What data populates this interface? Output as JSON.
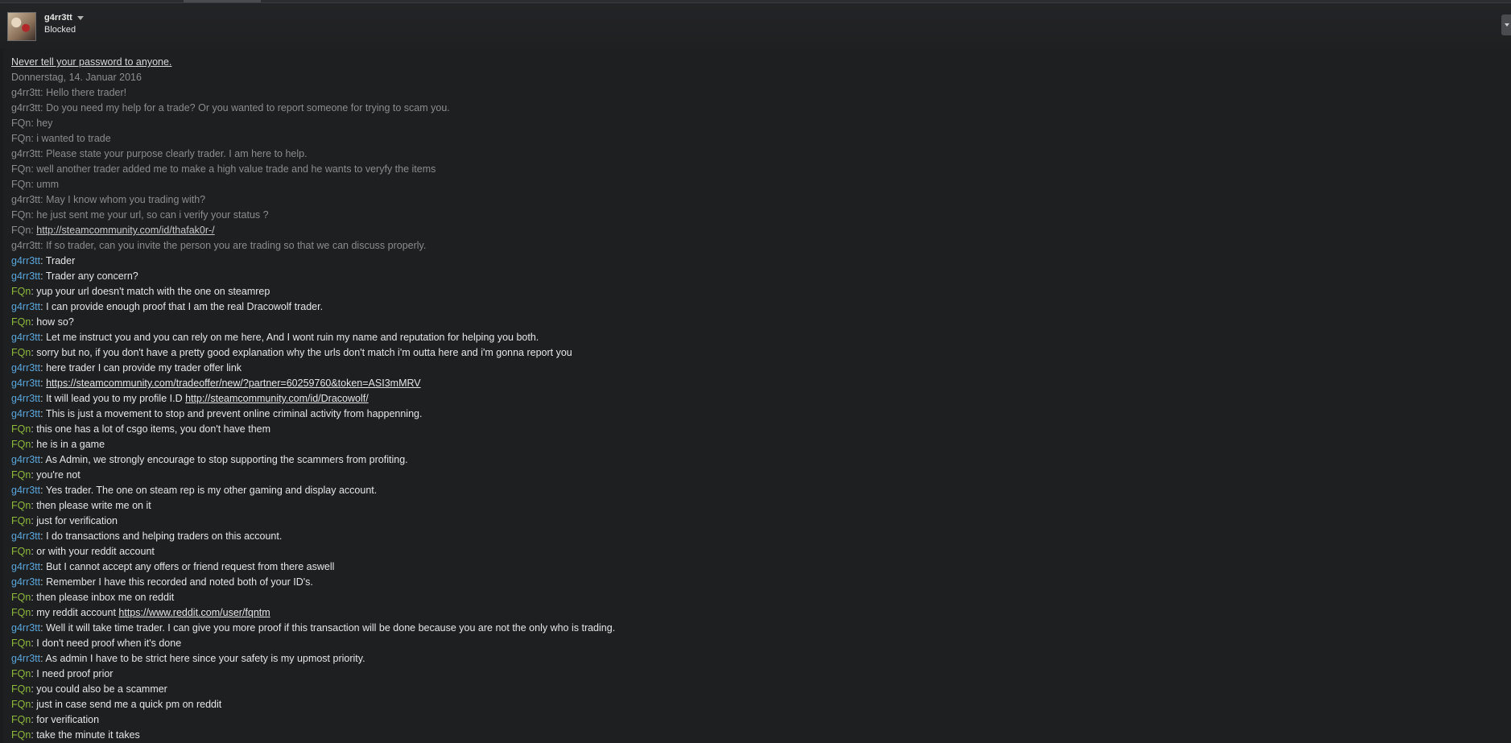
{
  "header": {
    "user_name": "g4rr3tt",
    "status": "Blocked"
  },
  "chat": {
    "warning": "Never tell your password to anyone.",
    "date": "Donnerstag, 14. Januar 2016",
    "messages": [
      {
        "sender": "g4rr3tt",
        "text": "Hello there trader!",
        "read": true
      },
      {
        "sender": "g4rr3tt",
        "text": "Do you need my help for a trade? Or you wanted to report someone for trying to scam you.",
        "read": true
      },
      {
        "sender": "FQn",
        "text": "hey",
        "read": true
      },
      {
        "sender": "FQn",
        "text": "i wanted to trade",
        "read": true
      },
      {
        "sender": "g4rr3tt",
        "text": "Please state your purpose clearly trader. I am here to help.",
        "read": true
      },
      {
        "sender": "FQn",
        "text": "well another trader added  me to make a high value trade and he wants to veryfy the items",
        "read": true
      },
      {
        "sender": "FQn",
        "text": "umm",
        "read": true
      },
      {
        "sender": "g4rr3tt",
        "text": "May I know whom you trading with?",
        "read": true
      },
      {
        "sender": "FQn",
        "text": "he just sent me your url, so can i verify your status ?",
        "read": true
      },
      {
        "sender": "FQn",
        "text": "",
        "link": "http://steamcommunity.com/id/thafak0r-/",
        "read": true
      },
      {
        "sender": "g4rr3tt",
        "text": "If so trader, can you invite the person you are trading so that we can discuss properly.",
        "read": true
      },
      {
        "sender": "g4rr3tt",
        "text": "Trader",
        "read": false
      },
      {
        "sender": "g4rr3tt",
        "text": "Trader any concern?",
        "read": false
      },
      {
        "sender": "FQn",
        "text": "yup your url doesn't match with the one on steamrep",
        "read": false
      },
      {
        "sender": "g4rr3tt",
        "text": "I can provide enough proof that I am the real Dracowolf trader.",
        "read": false
      },
      {
        "sender": "FQn",
        "text": "how so?",
        "read": false
      },
      {
        "sender": "g4rr3tt",
        "text": "Let me instruct you and you can rely on me here, And I wont ruin my name and reputation for helping you both.",
        "read": false
      },
      {
        "sender": "FQn",
        "text": "sorry but no, if you don't have a pretty good explanation why the urls don't match i'm outta here and i'm gonna report you",
        "read": false
      },
      {
        "sender": "g4rr3tt",
        "text": "here trader I can provide my trader offer link",
        "read": false
      },
      {
        "sender": "g4rr3tt",
        "text": "",
        "link": "https://steamcommunity.com/tradeoffer/new/?partner=60259760&token=ASI3mMRV",
        "read": false
      },
      {
        "sender": "g4rr3tt",
        "text": "It will lead you to my profile I.D ",
        "link": "http://steamcommunity.com/id/Dracowolf/",
        "read": false
      },
      {
        "sender": "g4rr3tt",
        "text": "This is just a movement to stop and prevent online criminal activity from happenning.",
        "read": false
      },
      {
        "sender": "FQn",
        "text": "this one has a lot of csgo items, you don't have them",
        "read": false
      },
      {
        "sender": "FQn",
        "text": "he is in a game",
        "read": false
      },
      {
        "sender": "g4rr3tt",
        "text": "As Admin, we strongly encourage to stop supporting the scammers from profiting.",
        "read": false
      },
      {
        "sender": "FQn",
        "text": "you're not",
        "read": false
      },
      {
        "sender": "g4rr3tt",
        "text": "Yes trader. The one on steam rep is my other gaming and display account.",
        "read": false
      },
      {
        "sender": "FQn",
        "text": "then please write me on it",
        "read": false
      },
      {
        "sender": "FQn",
        "text": "just for verification",
        "read": false
      },
      {
        "sender": "g4rr3tt",
        "text": "I do transactions and helping traders on this account.",
        "read": false
      },
      {
        "sender": "FQn",
        "text": "or with your reddit account",
        "read": false
      },
      {
        "sender": "g4rr3tt",
        "text": "But I cannot accept any offers or friend request from there aswell",
        "read": false
      },
      {
        "sender": "g4rr3tt",
        "text": "Remember I have this recorded and noted both of your ID's.",
        "read": false
      },
      {
        "sender": "FQn",
        "text": "then please inbox me on reddit",
        "read": false
      },
      {
        "sender": "FQn",
        "text": "my reddit account ",
        "link": "https://www.reddit.com/user/fqntm",
        "read": false
      },
      {
        "sender": "g4rr3tt",
        "text": "Well it will take time trader. I can give you more proof if this transaction will be done because you are not the only who is trading.",
        "read": false
      },
      {
        "sender": "FQn",
        "text": "I don't need proof when it's done",
        "read": false
      },
      {
        "sender": "g4rr3tt",
        "text": "As admin I have to be strict here since your safety is my upmost priority.",
        "read": false
      },
      {
        "sender": "FQn",
        "text": "I need proof prior",
        "read": false
      },
      {
        "sender": "FQn",
        "text": "you could also be a scammer",
        "read": false
      },
      {
        "sender": "FQn",
        "text": "just in case send me a quick pm on reddit",
        "read": false
      },
      {
        "sender": "FQn",
        "text": "for verification",
        "read": false
      },
      {
        "sender": "FQn",
        "text": "take the minute it takes",
        "read": false
      }
    ]
  },
  "colors": {
    "background": "#1e1f21",
    "sender_g4rr3tt": "#5aa6db",
    "sender_fqn": "#8fb93b",
    "read_text": "#8c8c8c",
    "unread_text": "#e6e6e6"
  },
  "icons": {
    "dropdown": "chevron-down-icon",
    "window_menu": "triangle-down-icon"
  }
}
